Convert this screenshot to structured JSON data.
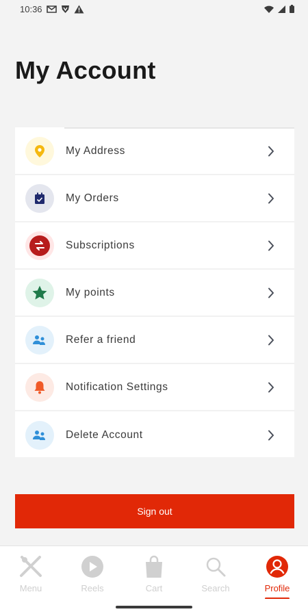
{
  "status_bar": {
    "time": "10:36"
  },
  "page": {
    "title": "My Account"
  },
  "menu": {
    "items": [
      {
        "label": "My Address",
        "icon": "location-pin-icon",
        "bg": "#fff8dc",
        "fg": "#f5b80f"
      },
      {
        "label": "My Orders",
        "icon": "calendar-icon",
        "bg": "#e4e6ee",
        "fg": "#1f2a6d"
      },
      {
        "label": "Subscriptions",
        "icon": "repeat-icon",
        "bg": "#ffe6e6",
        "fg": "#b71c1c"
      },
      {
        "label": "My points",
        "icon": "star-icon",
        "bg": "#dff3e8",
        "fg": "#1f7a4a"
      },
      {
        "label": "Refer a friend",
        "icon": "users-icon",
        "bg": "#e3f1fb",
        "fg": "#2f8fd8"
      },
      {
        "label": "Notification Settings",
        "icon": "bell-icon",
        "bg": "#fdeae4",
        "fg": "#f05a28"
      },
      {
        "label": "Delete Account",
        "icon": "users-icon",
        "bg": "#e3f1fb",
        "fg": "#2f8fd8"
      }
    ]
  },
  "actions": {
    "sign_out": "Sign out"
  },
  "bottom_nav": {
    "items": [
      {
        "label": "Menu",
        "icon": "fork-knife-icon"
      },
      {
        "label": "Reels",
        "icon": "play-icon"
      },
      {
        "label": "Cart",
        "icon": "shopping-bag-icon"
      },
      {
        "label": "Search",
        "icon": "search-icon"
      },
      {
        "label": "Profile",
        "icon": "profile-icon",
        "active": true
      }
    ]
  },
  "colors": {
    "accent": "#e12807",
    "nav_inactive": "#cfcfcf"
  }
}
